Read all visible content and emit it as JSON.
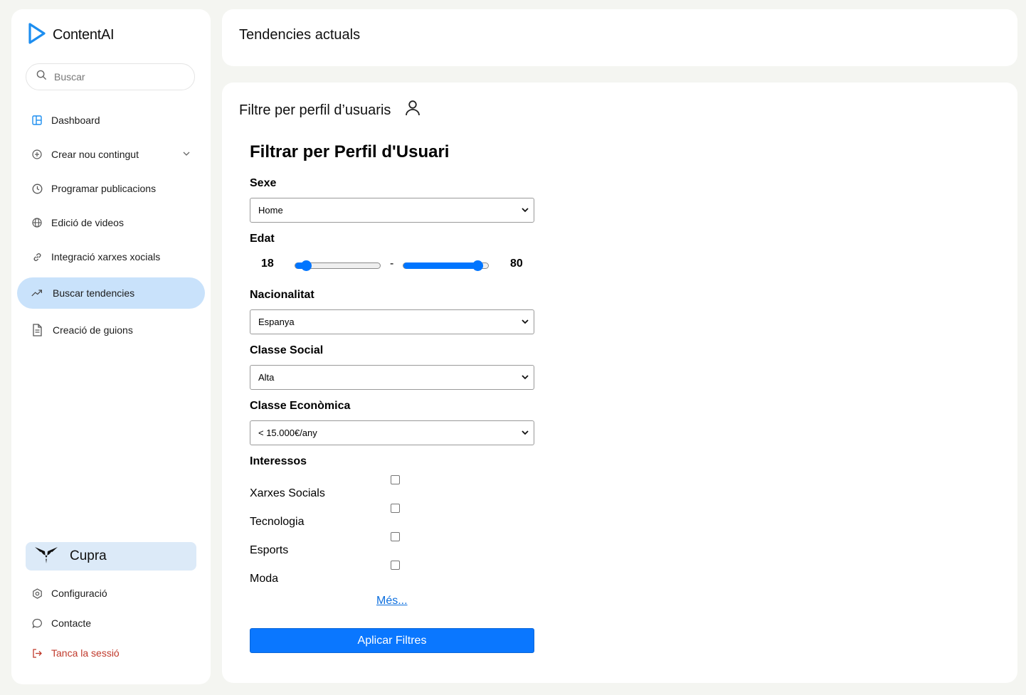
{
  "app": {
    "name": "ContentAI"
  },
  "search": {
    "placeholder": "Buscar"
  },
  "nav": {
    "items": [
      {
        "label": "Dashboard",
        "icon": "dashboard-icon"
      },
      {
        "label": "Crear nou contingut",
        "icon": "plus-circle-icon"
      },
      {
        "label": "Programar publicacions",
        "icon": "clock-icon"
      },
      {
        "label": "Edició de videos",
        "icon": "globe-icon"
      },
      {
        "label": "Integració xarxes xocials",
        "icon": "link-icon"
      },
      {
        "label": "Buscar tendencies",
        "icon": "trending-icon",
        "active": true
      },
      {
        "label": "Creació de guions",
        "icon": "document-icon"
      }
    ]
  },
  "brand": {
    "name": "Cupra"
  },
  "bottom_nav": {
    "settings": "Configuració",
    "contact": "Contacte",
    "logout": "Tanca la sessió"
  },
  "header": {
    "title": "Tendencies actuals"
  },
  "panel": {
    "title": "Filtre per perfil d’usuaris"
  },
  "form": {
    "title": "Filtrar per Perfil d'Usuari",
    "sex": {
      "label": "Sexe",
      "value": "Home"
    },
    "age": {
      "label": "Edat",
      "min": "18",
      "max": "80",
      "separator": "-"
    },
    "nationality": {
      "label": "Nacionalitat",
      "value": "Espanya"
    },
    "social_class": {
      "label": "Classe Social",
      "value": "Alta"
    },
    "economic_class": {
      "label": "Classe Econòmica",
      "value": "< 15.000€/any"
    },
    "interests": {
      "label": "Interessos",
      "options": [
        "Xarxes Socials",
        "Tecnologia",
        "Esports",
        "Moda"
      ],
      "more": "Més..."
    },
    "apply": "Aplicar Filtres"
  },
  "colors": {
    "accent": "#0a77ff",
    "active_nav": "#c9e2fb",
    "brand_bg": "#dceaf8",
    "logout": "#c0392b"
  }
}
